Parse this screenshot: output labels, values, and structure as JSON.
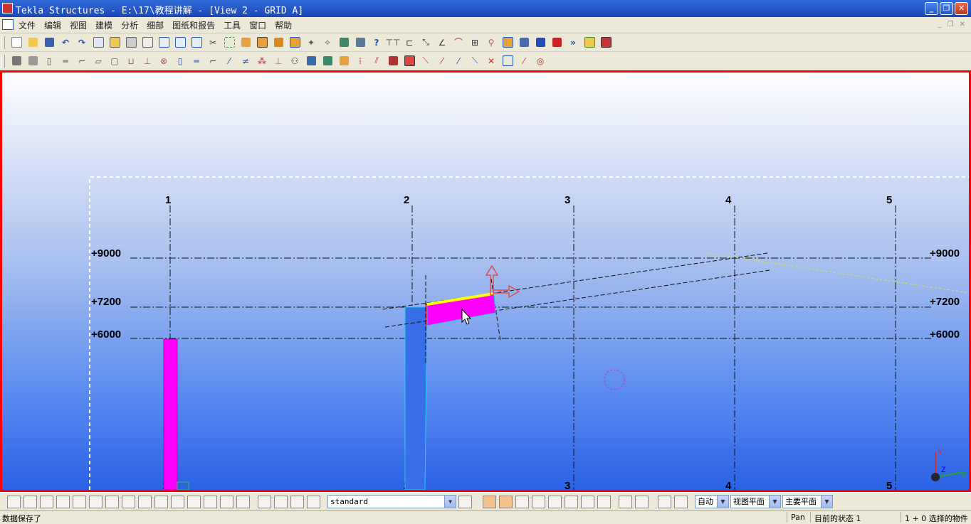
{
  "window": {
    "title": "Tekla Structures - E:\\17\\教程讲解 - [View 2 - GRID A]",
    "minimize": "_",
    "maximize": "❐",
    "close": "✕"
  },
  "menu": {
    "items": [
      "文件",
      "编辑",
      "视图",
      "建模",
      "分析",
      "细部",
      "图纸和报告",
      "工具",
      "窗口",
      "帮助"
    ],
    "mdi_min": "_",
    "mdi_restore": "❐",
    "mdi_close": "✕"
  },
  "view": {
    "grid_labels": [
      "1",
      "2",
      "3",
      "4",
      "5"
    ],
    "levels": [
      "+9000",
      "+7200",
      "+6000"
    ],
    "colors": {
      "frame": "#ff0000",
      "selected_part": "#ff00ff",
      "column": "#3a6de8",
      "highlight": "#ffff00"
    }
  },
  "bottom_toolbar": {
    "filter_value": "standard",
    "snap_mode": "自动",
    "plane_mode": "视图平面",
    "work_plane": "主要平面"
  },
  "status": {
    "message": "数据保存了",
    "mode": "Pan",
    "current_state": "目前的状态 1",
    "selection": "1 + 0 选择的物件"
  }
}
